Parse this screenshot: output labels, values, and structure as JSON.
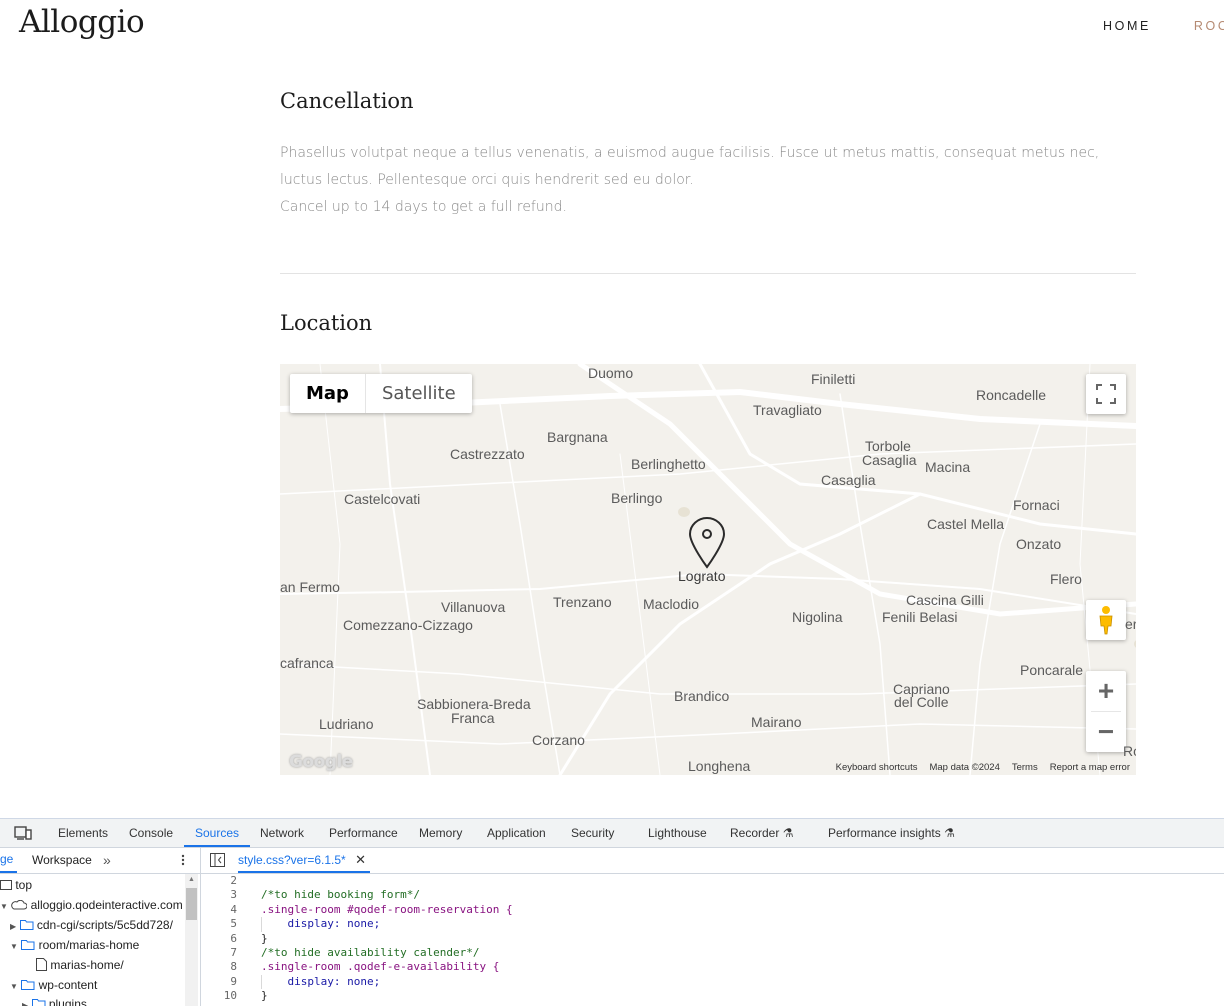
{
  "site": {
    "logo": "Alloggio",
    "nav": {
      "home": "HOME",
      "rooms": "ROO"
    },
    "cancellation": {
      "title": "Cancellation",
      "line1": "Phasellus volutpat neque a tellus venenatis, a euismod augue facilisis. Fusce ut metus mattis, consequat metus nec,",
      "line2": "luctus lectus. Pellentesque orci quis hendrerit sed eu dolor.",
      "line3": "Cancel up to 14 days to get a full refund."
    },
    "location": {
      "title": "Location"
    }
  },
  "map": {
    "type_map": "Map",
    "type_satellite": "Satellite",
    "zoom_in": "+",
    "zoom_out": "−",
    "google": "Google",
    "attribution": {
      "shortcuts": "Keyboard shortcuts",
      "data": "Map data ©2024",
      "terms": "Terms",
      "report": "Report a map error"
    },
    "places": [
      "Duomo",
      "Finiletti",
      "Roncadelle",
      "Travagliato",
      "Bargnana",
      "Castrezzato",
      "Berlinghetto",
      "Torbole",
      "Casaglia",
      "Macina",
      "Casaglia",
      "Castelcovati",
      "Berlingo",
      "Fornaci",
      "Castel Mella",
      "Onzato",
      "Lograto",
      "an Fermo",
      "Flero",
      "Villanuova",
      "Trenzano",
      "Maclodio",
      "Cascina Gilli",
      "Nigolina",
      "Fenili Belasi",
      "Comezzano-Cizzago",
      "er",
      "cafranca",
      "Poncarale",
      "Brandico",
      "Capriano",
      "del Colle",
      "Sabbionera-Breda",
      "Franca",
      "Ludriano",
      "Mairano",
      "Corzano",
      "Ro",
      "Longhena"
    ],
    "colors": {
      "bg": "#f3f1ec",
      "road": "#ffffff",
      "pin": "#2b2b2b"
    }
  },
  "devtools": {
    "tabs": [
      "Elements",
      "Console",
      "Sources",
      "Network",
      "Performance",
      "Memory",
      "Application",
      "Security",
      "Lighthouse",
      "Recorder",
      "Performance insights"
    ],
    "active_tab": "Sources",
    "nav_tabs": {
      "page": "ge",
      "workspace": "Workspace",
      "more": "»"
    },
    "tree": {
      "top": "top",
      "domain": "alloggio.qodeinteractive.com",
      "cdn": "cdn-cgi/scripts/5c5dd728/",
      "room": "room/marias-home",
      "marias": "marias-home/",
      "wp": "wp-content",
      "plugins": "plugins"
    },
    "file_tab": "style.css?ver=6.1.5*",
    "code": [
      {
        "n": "2",
        "t": ""
      },
      {
        "n": "3",
        "t": "/*to hide booking form*/"
      },
      {
        "n": "4",
        "t": ".single-room #qodef-room-reservation {"
      },
      {
        "n": "5",
        "t": "    display: none;"
      },
      {
        "n": "6",
        "t": "}"
      },
      {
        "n": "7",
        "t": "/*to hide availability calender*/"
      },
      {
        "n": "8",
        "t": ".single-room .qodef-e-availability {"
      },
      {
        "n": "9",
        "t": "    display: none;"
      },
      {
        "n": "10",
        "t": "}"
      }
    ],
    "colors": {
      "accent": "#1a73e8",
      "comment": "#236e25",
      "selector": "#881280",
      "property": "#1a1aa6"
    }
  }
}
